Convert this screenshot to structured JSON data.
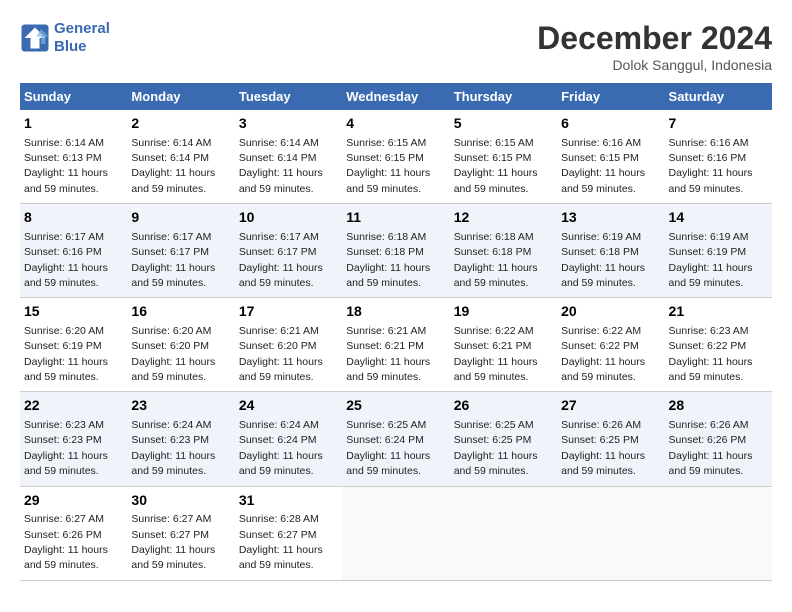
{
  "logo": {
    "line1": "General",
    "line2": "Blue"
  },
  "title": "December 2024",
  "location": "Dolok Sanggul, Indonesia",
  "days_header": [
    "Sunday",
    "Monday",
    "Tuesday",
    "Wednesday",
    "Thursday",
    "Friday",
    "Saturday"
  ],
  "weeks": [
    [
      {
        "day": 1,
        "sunrise": "6:14 AM",
        "sunset": "6:13 PM",
        "daylight": "11 hours and 59 minutes."
      },
      {
        "day": 2,
        "sunrise": "6:14 AM",
        "sunset": "6:14 PM",
        "daylight": "11 hours and 59 minutes."
      },
      {
        "day": 3,
        "sunrise": "6:14 AM",
        "sunset": "6:14 PM",
        "daylight": "11 hours and 59 minutes."
      },
      {
        "day": 4,
        "sunrise": "6:15 AM",
        "sunset": "6:15 PM",
        "daylight": "11 hours and 59 minutes."
      },
      {
        "day": 5,
        "sunrise": "6:15 AM",
        "sunset": "6:15 PM",
        "daylight": "11 hours and 59 minutes."
      },
      {
        "day": 6,
        "sunrise": "6:16 AM",
        "sunset": "6:15 PM",
        "daylight": "11 hours and 59 minutes."
      },
      {
        "day": 7,
        "sunrise": "6:16 AM",
        "sunset": "6:16 PM",
        "daylight": "11 hours and 59 minutes."
      }
    ],
    [
      {
        "day": 8,
        "sunrise": "6:17 AM",
        "sunset": "6:16 PM",
        "daylight": "11 hours and 59 minutes."
      },
      {
        "day": 9,
        "sunrise": "6:17 AM",
        "sunset": "6:17 PM",
        "daylight": "11 hours and 59 minutes."
      },
      {
        "day": 10,
        "sunrise": "6:17 AM",
        "sunset": "6:17 PM",
        "daylight": "11 hours and 59 minutes."
      },
      {
        "day": 11,
        "sunrise": "6:18 AM",
        "sunset": "6:18 PM",
        "daylight": "11 hours and 59 minutes."
      },
      {
        "day": 12,
        "sunrise": "6:18 AM",
        "sunset": "6:18 PM",
        "daylight": "11 hours and 59 minutes."
      },
      {
        "day": 13,
        "sunrise": "6:19 AM",
        "sunset": "6:18 PM",
        "daylight": "11 hours and 59 minutes."
      },
      {
        "day": 14,
        "sunrise": "6:19 AM",
        "sunset": "6:19 PM",
        "daylight": "11 hours and 59 minutes."
      }
    ],
    [
      {
        "day": 15,
        "sunrise": "6:20 AM",
        "sunset": "6:19 PM",
        "daylight": "11 hours and 59 minutes."
      },
      {
        "day": 16,
        "sunrise": "6:20 AM",
        "sunset": "6:20 PM",
        "daylight": "11 hours and 59 minutes."
      },
      {
        "day": 17,
        "sunrise": "6:21 AM",
        "sunset": "6:20 PM",
        "daylight": "11 hours and 59 minutes."
      },
      {
        "day": 18,
        "sunrise": "6:21 AM",
        "sunset": "6:21 PM",
        "daylight": "11 hours and 59 minutes."
      },
      {
        "day": 19,
        "sunrise": "6:22 AM",
        "sunset": "6:21 PM",
        "daylight": "11 hours and 59 minutes."
      },
      {
        "day": 20,
        "sunrise": "6:22 AM",
        "sunset": "6:22 PM",
        "daylight": "11 hours and 59 minutes."
      },
      {
        "day": 21,
        "sunrise": "6:23 AM",
        "sunset": "6:22 PM",
        "daylight": "11 hours and 59 minutes."
      }
    ],
    [
      {
        "day": 22,
        "sunrise": "6:23 AM",
        "sunset": "6:23 PM",
        "daylight": "11 hours and 59 minutes."
      },
      {
        "day": 23,
        "sunrise": "6:24 AM",
        "sunset": "6:23 PM",
        "daylight": "11 hours and 59 minutes."
      },
      {
        "day": 24,
        "sunrise": "6:24 AM",
        "sunset": "6:24 PM",
        "daylight": "11 hours and 59 minutes."
      },
      {
        "day": 25,
        "sunrise": "6:25 AM",
        "sunset": "6:24 PM",
        "daylight": "11 hours and 59 minutes."
      },
      {
        "day": 26,
        "sunrise": "6:25 AM",
        "sunset": "6:25 PM",
        "daylight": "11 hours and 59 minutes."
      },
      {
        "day": 27,
        "sunrise": "6:26 AM",
        "sunset": "6:25 PM",
        "daylight": "11 hours and 59 minutes."
      },
      {
        "day": 28,
        "sunrise": "6:26 AM",
        "sunset": "6:26 PM",
        "daylight": "11 hours and 59 minutes."
      }
    ],
    [
      {
        "day": 29,
        "sunrise": "6:27 AM",
        "sunset": "6:26 PM",
        "daylight": "11 hours and 59 minutes."
      },
      {
        "day": 30,
        "sunrise": "6:27 AM",
        "sunset": "6:27 PM",
        "daylight": "11 hours and 59 minutes."
      },
      {
        "day": 31,
        "sunrise": "6:28 AM",
        "sunset": "6:27 PM",
        "daylight": "11 hours and 59 minutes."
      },
      null,
      null,
      null,
      null
    ]
  ]
}
